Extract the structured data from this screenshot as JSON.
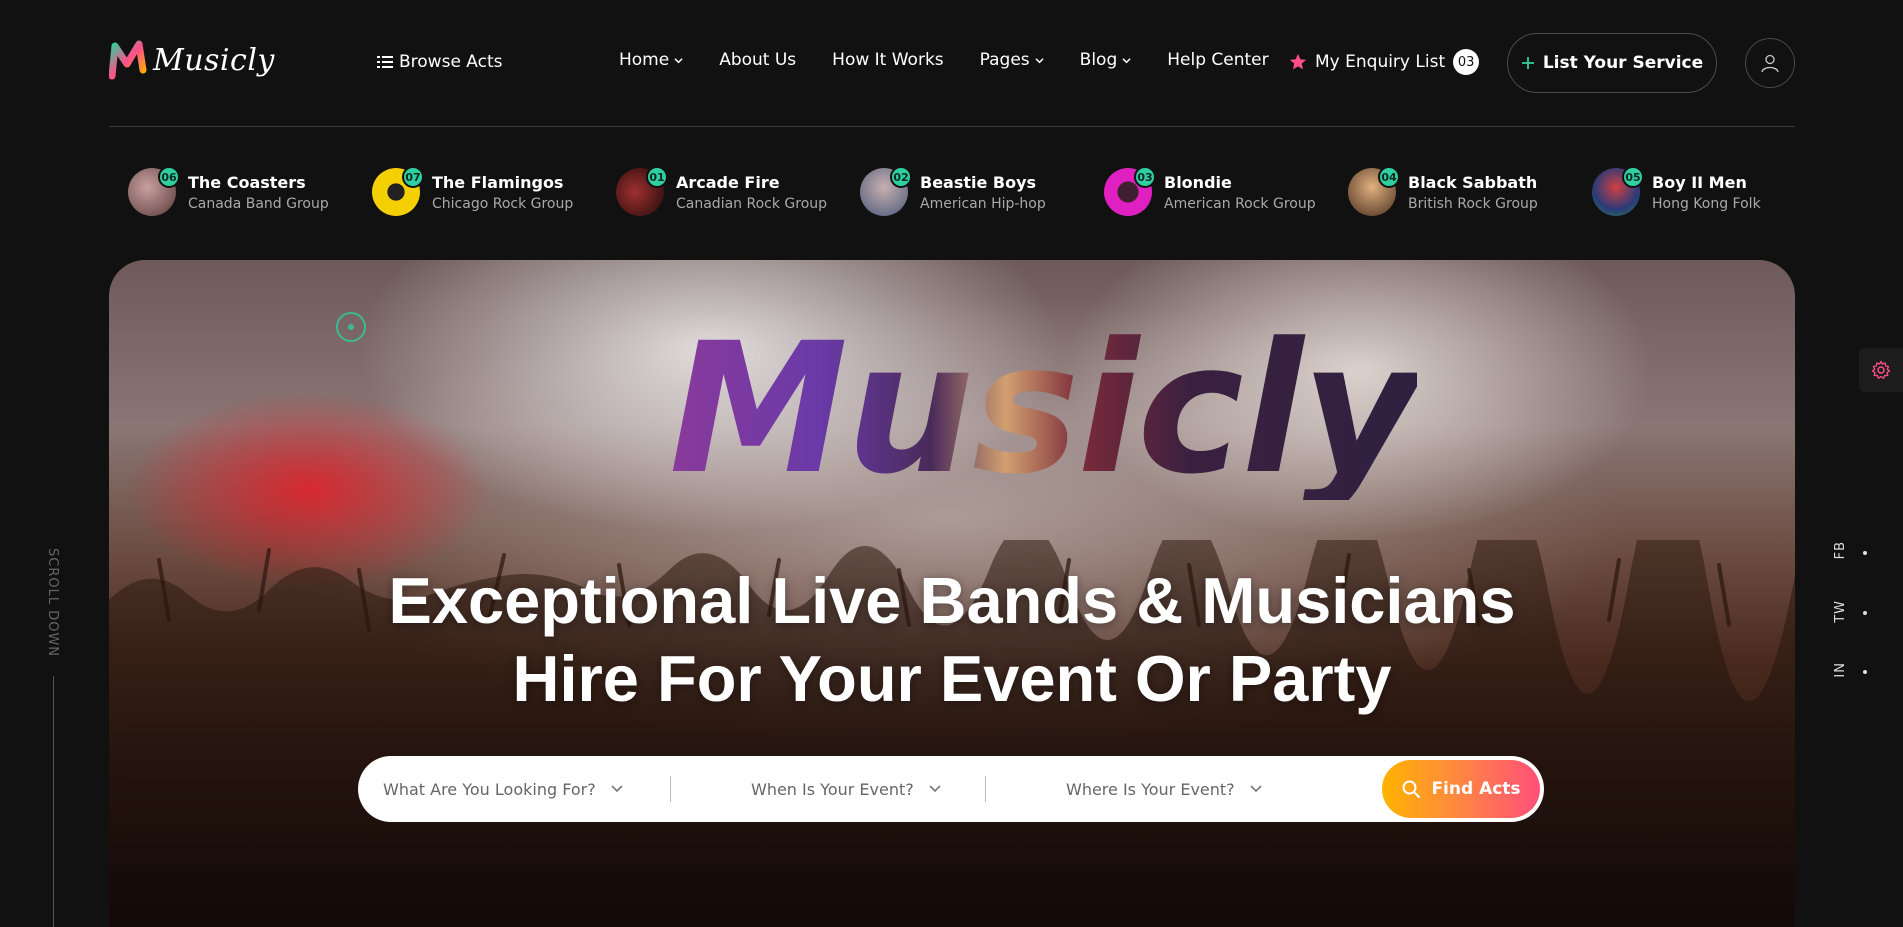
{
  "header": {
    "logo_text": "Musicly",
    "browse_label": "Browse Acts",
    "nav": [
      {
        "label": "Home",
        "dropdown": true
      },
      {
        "label": "About Us",
        "dropdown": false
      },
      {
        "label": "How It Works",
        "dropdown": false
      },
      {
        "label": "Pages",
        "dropdown": true
      },
      {
        "label": "Blog",
        "dropdown": true
      },
      {
        "label": "Help Center",
        "dropdown": false
      }
    ],
    "enquiry_label": "My Enquiry List",
    "enquiry_count": "03",
    "list_service_label": "List Your Service"
  },
  "artists": [
    {
      "badge": "06",
      "name": "The Coasters",
      "sub": "Canada Band Group",
      "color": "#8a6a6a"
    },
    {
      "badge": "07",
      "name": "The Flamingos",
      "sub": "Chicago Rock Group",
      "color": "#f5d000"
    },
    {
      "badge": "01",
      "name": "Arcade Fire",
      "sub": "Canadian Rock Group",
      "color": "#5a2020"
    },
    {
      "badge": "02",
      "name": "Beastie Boys",
      "sub": "American Hip-hop",
      "color": "#7a8aa0"
    },
    {
      "badge": "03",
      "name": "Blondie",
      "sub": "American Rock Group",
      "color": "#e020c0"
    },
    {
      "badge": "04",
      "name": "Black Sabbath",
      "sub": "British Rock Group",
      "color": "#a07850"
    },
    {
      "badge": "05",
      "name": "Boy II Men",
      "sub": "Hong Kong Folk",
      "color": "#3a5a9a"
    }
  ],
  "hero": {
    "logo_text": "Musicly",
    "title_line1": "Exceptional Live Bands & Musicians",
    "title_line2": "Hire For Your Event Or Party"
  },
  "search": {
    "field1": "What Are You Looking For?",
    "field2": "When Is Your Event?",
    "field3": "Where Is Your Event?",
    "button_label": "Find Acts"
  },
  "side": {
    "scroll_label": "SCROLL DOWN",
    "social": [
      "FB",
      "TW",
      "IN"
    ]
  },
  "colors": {
    "accent_green": "#2fcf9f",
    "button_gradient_start": "#ffb300",
    "button_gradient_end": "#ff4f7a",
    "star": "#ff4f8a"
  }
}
